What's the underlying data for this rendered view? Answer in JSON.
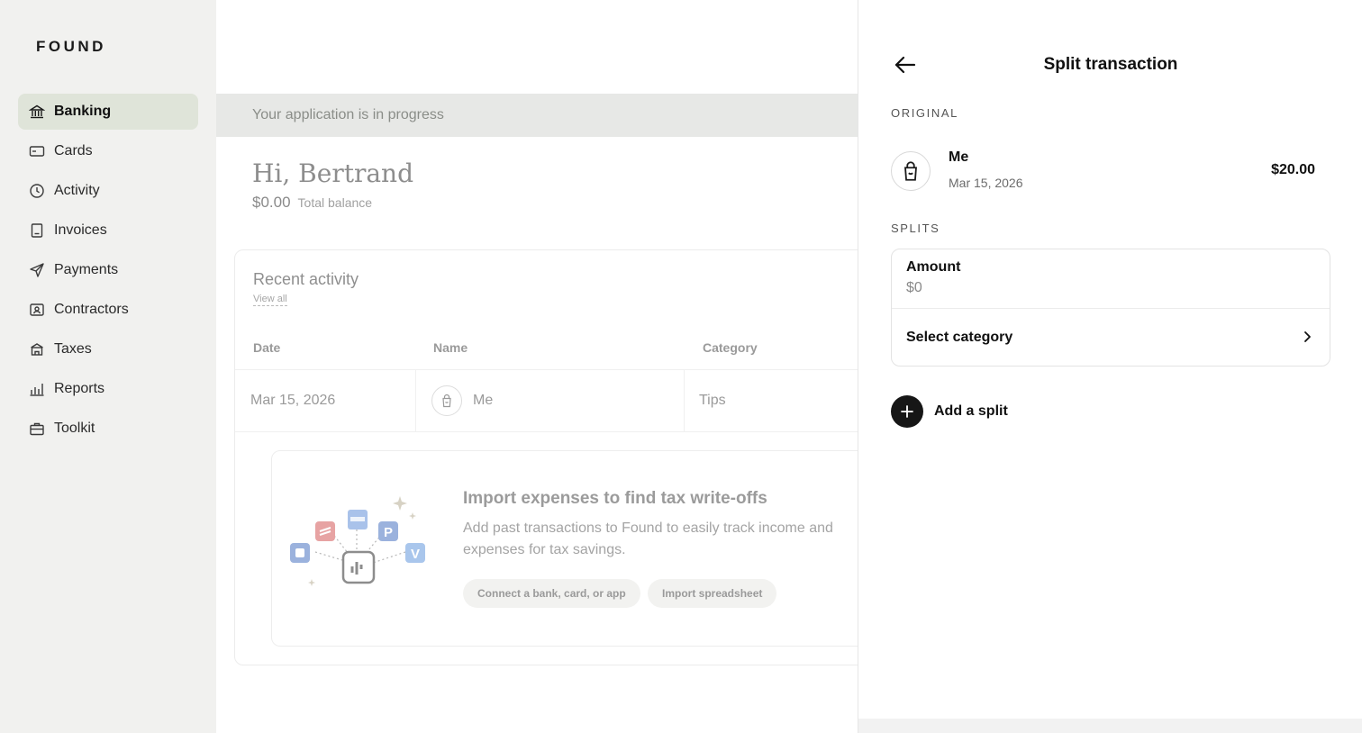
{
  "app": {
    "logo": "FOUND"
  },
  "sidebar": {
    "items": [
      {
        "label": "Banking",
        "icon": "bank-icon",
        "active": true
      },
      {
        "label": "Cards",
        "icon": "card-icon"
      },
      {
        "label": "Activity",
        "icon": "clock-icon"
      },
      {
        "label": "Invoices",
        "icon": "invoice-icon"
      },
      {
        "label": "Payments",
        "icon": "send-icon"
      },
      {
        "label": "Contractors",
        "icon": "contractor-icon"
      },
      {
        "label": "Taxes",
        "icon": "taxes-icon"
      },
      {
        "label": "Reports",
        "icon": "bar-chart-icon"
      },
      {
        "label": "Toolkit",
        "icon": "briefcase-icon"
      }
    ]
  },
  "main": {
    "banner": "Your application is in progress",
    "greeting": "Hi, Bertrand",
    "balance": {
      "amount": "$0.00",
      "label": "Total balance"
    },
    "recent": {
      "title": "Recent activity",
      "view_all": "View all",
      "headers": {
        "date": "Date",
        "name": "Name",
        "category": "Category"
      },
      "rows": [
        {
          "date": "Mar 15, 2026",
          "name": "Me",
          "category": "Tips",
          "icon": "bag-icon"
        }
      ]
    },
    "import": {
      "title": "Import expenses to find tax write-offs",
      "description": "Add past transactions to Found to easily track income and expenses for tax savings.",
      "connect_button": "Connect a bank, card, or app",
      "spreadsheet_button": "Import spreadsheet"
    }
  },
  "panel": {
    "title": "Split transaction",
    "original_label": "ORIGINAL",
    "original": {
      "name": "Me",
      "date": "Mar 15, 2026",
      "amount": "$20.00",
      "icon": "bag-icon"
    },
    "splits_label": "SPLITS",
    "split": {
      "amount_label": "Amount",
      "amount_placeholder": "$0",
      "category_label": "Select category"
    },
    "add_split": "Add a split"
  },
  "colors": {
    "active_nav_bg": "#dfe4d9",
    "sidebar_bg": "#f1f1ef",
    "banner_bg": "#e7e8e6",
    "add_button_bg": "#161616"
  }
}
